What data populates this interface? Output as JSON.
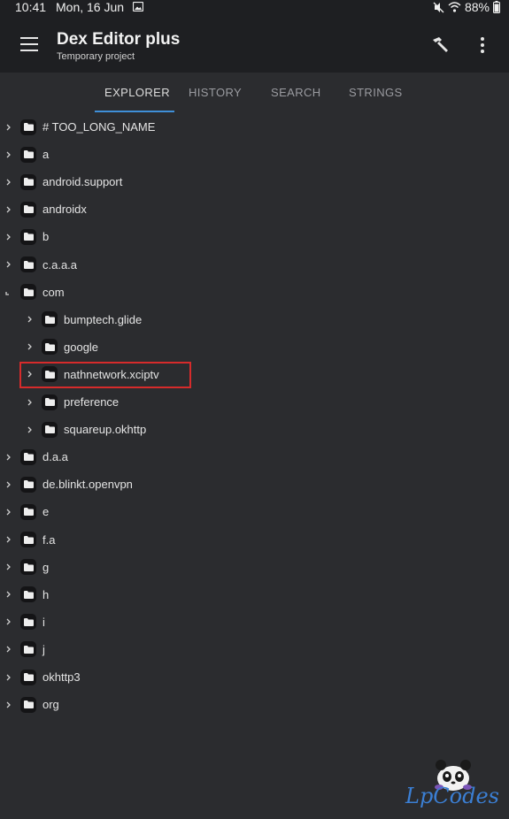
{
  "status_bar": {
    "time": "10:41",
    "date": "Mon, 16 Jun",
    "battery": "88%",
    "icons": [
      "gallery-icon",
      "mute-icon",
      "wifi-icon",
      "battery-icon"
    ]
  },
  "app_bar": {
    "title": "Dex Editor plus",
    "subtitle": "Temporary project",
    "icons": [
      "menu-icon",
      "hammer-icon",
      "more-vert-icon"
    ]
  },
  "tabs": [
    {
      "label": "EXPLORER",
      "active": true
    },
    {
      "label": "HISTORY",
      "active": false
    },
    {
      "label": "SEARCH",
      "active": false
    },
    {
      "label": "STRINGS",
      "active": false
    }
  ],
  "tree": [
    {
      "label": "# TOO_LONG_NAME",
      "level": 0,
      "expanded": false
    },
    {
      "label": "a",
      "level": 0,
      "expanded": false
    },
    {
      "label": "android.support",
      "level": 0,
      "expanded": false
    },
    {
      "label": "androidx",
      "level": 0,
      "expanded": false
    },
    {
      "label": "b",
      "level": 0,
      "expanded": false
    },
    {
      "label": "c.a.a.a",
      "level": 0,
      "expanded": false
    },
    {
      "label": "com",
      "level": 0,
      "expanded": true
    },
    {
      "label": "bumptech.glide",
      "level": 1,
      "expanded": false
    },
    {
      "label": "google",
      "level": 1,
      "expanded": false
    },
    {
      "label": "nathnetwork.xciptv",
      "level": 1,
      "expanded": false,
      "highlighted": true
    },
    {
      "label": "preference",
      "level": 1,
      "expanded": false
    },
    {
      "label": "squareup.okhttp",
      "level": 1,
      "expanded": false
    },
    {
      "label": "d.a.a",
      "level": 0,
      "expanded": false
    },
    {
      "label": "de.blinkt.openvpn",
      "level": 0,
      "expanded": false
    },
    {
      "label": "e",
      "level": 0,
      "expanded": false
    },
    {
      "label": "f.a",
      "level": 0,
      "expanded": false
    },
    {
      "label": "g",
      "level": 0,
      "expanded": false
    },
    {
      "label": "h",
      "level": 0,
      "expanded": false
    },
    {
      "label": "i",
      "level": 0,
      "expanded": false
    },
    {
      "label": "j",
      "level": 0,
      "expanded": false
    },
    {
      "label": "okhttp3",
      "level": 0,
      "expanded": false
    },
    {
      "label": "org",
      "level": 0,
      "expanded": false
    }
  ],
  "watermark": {
    "text": "LpCodes"
  },
  "colors": {
    "background": "#2b2c2f",
    "appbar": "#1e1f22",
    "accent": "#3f8fd8",
    "highlight": "#d62b2b"
  }
}
